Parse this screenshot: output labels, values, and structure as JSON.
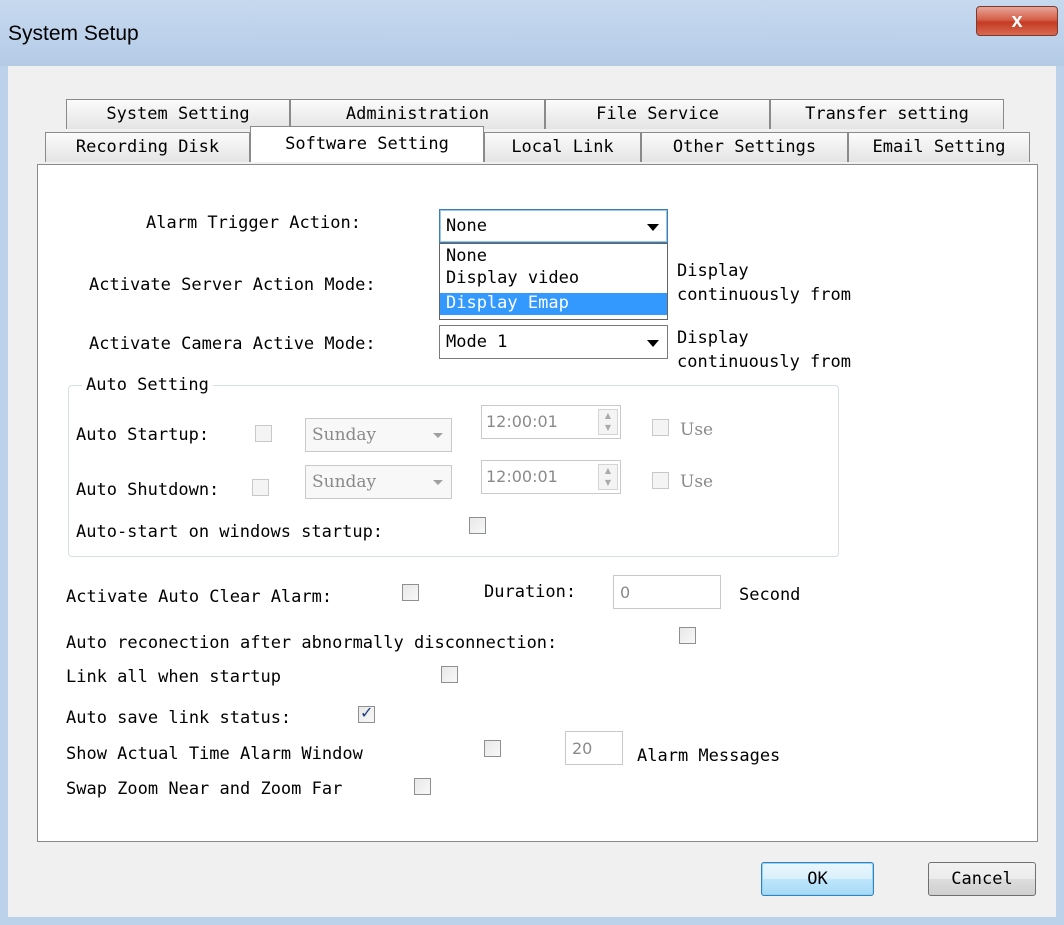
{
  "window": {
    "title": "System Setup",
    "close_label": "x"
  },
  "tabs_row1": [
    "System Setting",
    "Administration",
    "File Service",
    "Transfer setting"
  ],
  "tabs_row2": [
    "Recording Disk",
    "Software Setting",
    "Local Link",
    "Other Settings",
    "Email Setting"
  ],
  "active_tab": "Software Setting",
  "alarm_trigger": {
    "label": "Alarm Trigger Action:",
    "value": "None",
    "options": [
      "None",
      "Display video",
      "Display Emap"
    ],
    "highlighted": "Display Emap"
  },
  "server_action": {
    "label": "Activate Server Action Mode:",
    "note_line1": "Display",
    "note_line2": "continuously from"
  },
  "camera_active": {
    "label": "Activate Camera Active Mode:",
    "value": "Mode 1",
    "note_line1": "Display",
    "note_line2": "continuously from"
  },
  "auto_setting": {
    "title": "Auto Setting",
    "startup": {
      "label": "Auto Startup:",
      "day": "Sunday",
      "time": "12:00:01",
      "use_label": "Use"
    },
    "shutdown": {
      "label": "Auto Shutdown:",
      "day": "Sunday",
      "time": "12:00:01",
      "use_label": "Use"
    },
    "windows_startup_label": "Auto-start on windows startup:"
  },
  "auto_clear": {
    "label": "Activate Auto Clear Alarm:",
    "duration_label": "Duration:",
    "duration_value": "0",
    "unit": "Second"
  },
  "reconnect_label": "Auto reconection after abnormally disconnection:",
  "link_all_label": "Link all when startup",
  "save_link_label": "Auto save link status:",
  "alarm_window": {
    "label": "Show Actual Time Alarm Window",
    "count": "20",
    "unit": "Alarm Messages"
  },
  "swap_zoom_label": "Swap Zoom Near and Zoom Far",
  "buttons": {
    "ok": "OK",
    "cancel": "Cancel"
  },
  "colors": {
    "selection": "#3399ff",
    "titlebar": "#bcd1ea",
    "close": "#c43b22"
  }
}
